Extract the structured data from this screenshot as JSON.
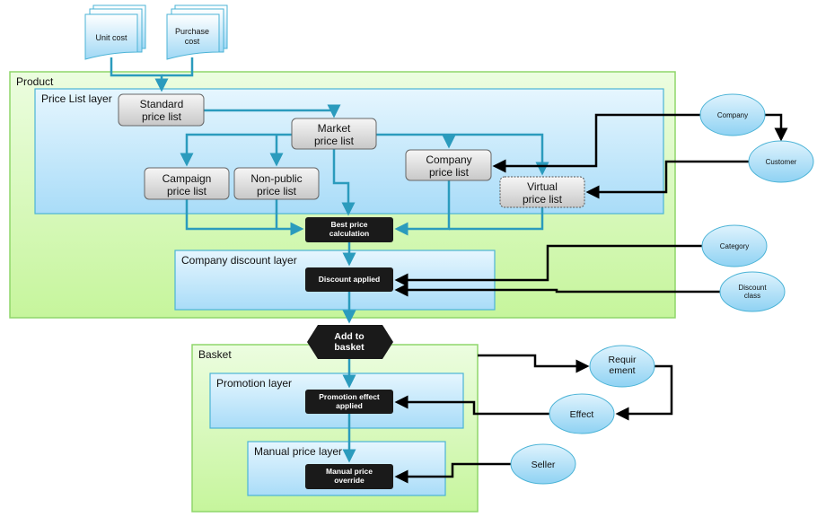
{
  "containers": {
    "product": "Product",
    "price_list_layer": "Price List layer",
    "company_discount_layer": "Company discount layer",
    "basket": "Basket",
    "promotion_layer": "Promotion layer",
    "manual_price_layer": "Manual price layer"
  },
  "documents": {
    "unit_cost": [
      "Unit cost"
    ],
    "purchase_cost": [
      "Purchase",
      "cost"
    ]
  },
  "price_lists": {
    "standard": [
      "Standard",
      "price list"
    ],
    "market": [
      "Market",
      "price list"
    ],
    "campaign": [
      "Campaign",
      "price list"
    ],
    "non_public": [
      "Non-public",
      "price list"
    ],
    "company": [
      "Company",
      "price list"
    ],
    "virtual": [
      "Virtual",
      "price list"
    ]
  },
  "processes": {
    "best_price": [
      "Best price",
      "calculation"
    ],
    "discount_applied": [
      "Discount applied"
    ],
    "add_to_basket": [
      "Add to",
      "basket"
    ],
    "promotion_effect": [
      "Promotion effect",
      "applied"
    ],
    "manual_override": [
      "Manual price",
      "override"
    ]
  },
  "entities": {
    "company": [
      "Company"
    ],
    "customer": [
      "Customer"
    ],
    "category": [
      "Category"
    ],
    "discount_class": [
      "Discount",
      "class"
    ],
    "requirement": [
      "Requir",
      "ement"
    ],
    "effect": [
      "Effect"
    ],
    "seller": [
      "Seller"
    ]
  },
  "colors": {
    "flow": "#2b9bbd",
    "input": "#000000",
    "product_fill": "#d4f7b4",
    "layer_fill": "#bfe6fb",
    "process_fill": "#1a1a1a",
    "entity_fill": "#a8dcf5"
  }
}
